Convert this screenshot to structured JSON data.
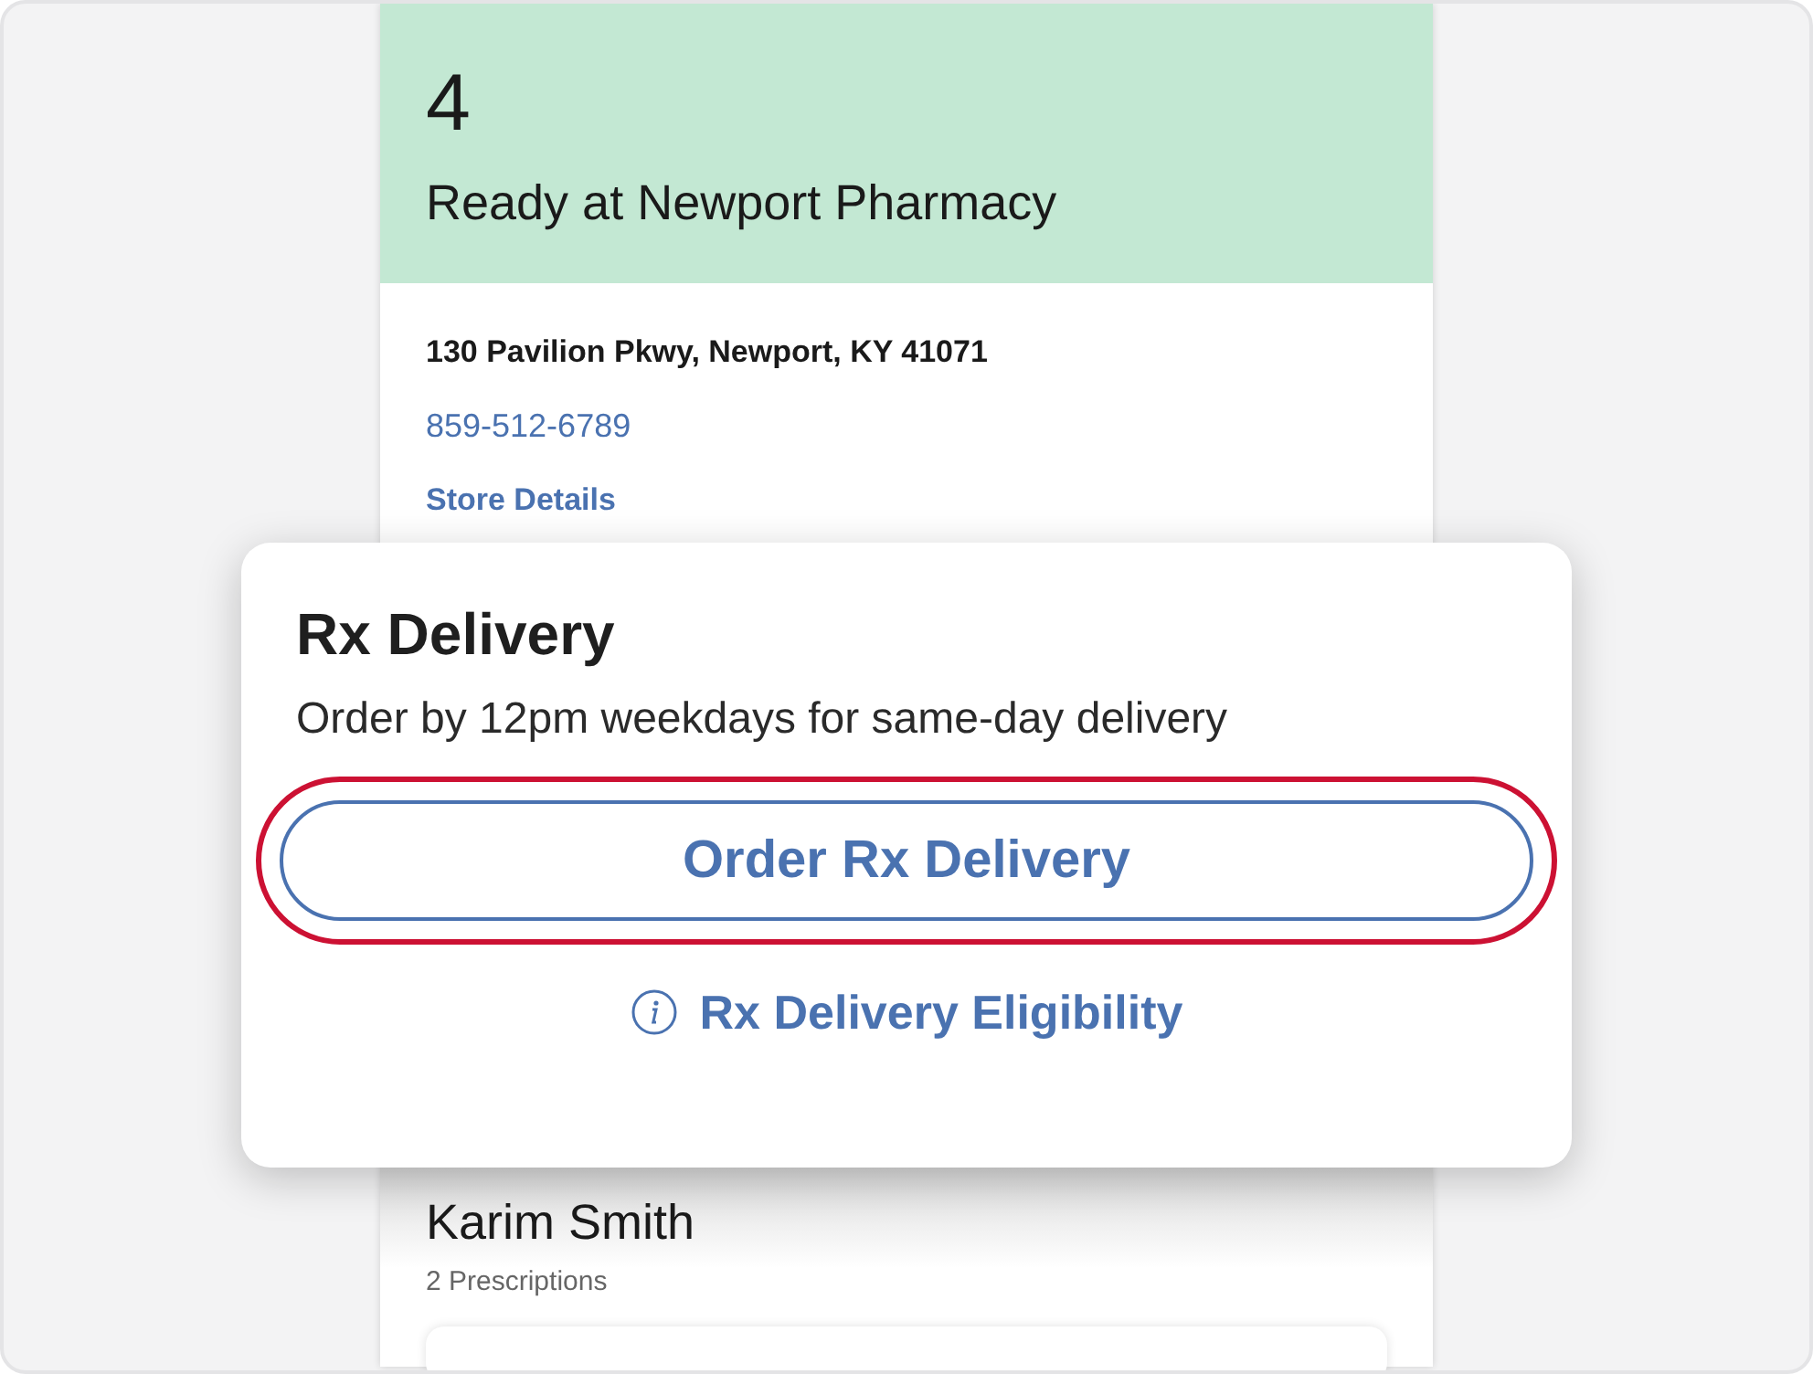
{
  "pharmacy_card": {
    "count": "4",
    "status": "Ready at Newport Pharmacy",
    "address": "130 Pavilion Pkwy, Newport, KY 41071",
    "phone": "859-512-6789",
    "details_link": "Store Details"
  },
  "patient": {
    "name": "Karim Smith",
    "prescriptions": "2 Prescriptions"
  },
  "delivery_popup": {
    "title": "Rx Delivery",
    "subtitle": "Order by 12pm weekdays for same-day delivery",
    "button": {
      "label": "Order Rx Delivery",
      "highlighted": true
    },
    "eligibility_link": "Rx Delivery Eligibility"
  }
}
